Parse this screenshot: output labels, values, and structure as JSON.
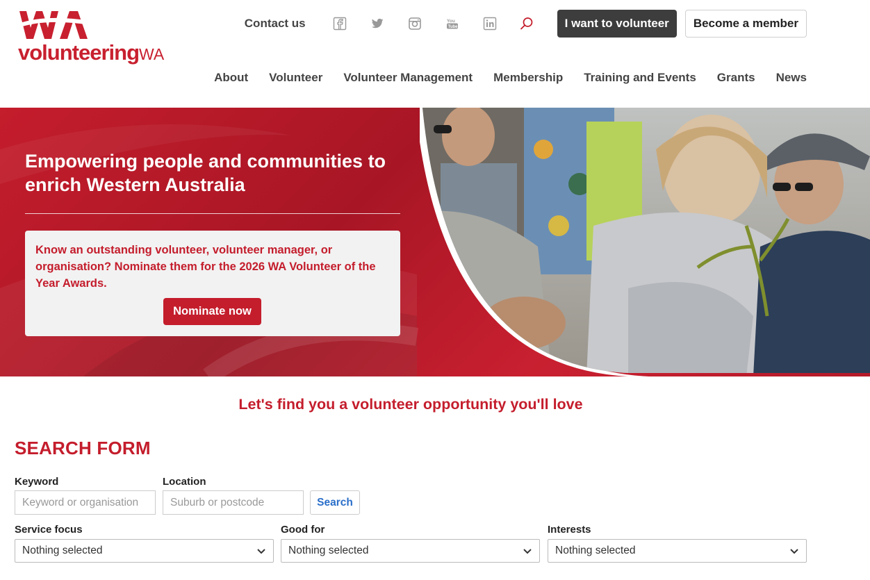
{
  "brand": {
    "logo_text_main": "volunteering",
    "logo_text_suffix": "WA",
    "colors": {
      "primary_red": "#c41d2c",
      "dark_button": "#3d3d3d",
      "link_blue": "#2a6fc9"
    }
  },
  "topbar": {
    "contact": "Contact us",
    "social_icons": [
      "facebook-icon",
      "twitter-icon",
      "instagram-icon",
      "youtube-icon",
      "linkedin-icon"
    ],
    "search_icon": "search-icon",
    "volunteer_button": "I want to volunteer",
    "member_button": "Become a member"
  },
  "nav": {
    "items": [
      {
        "label": "About"
      },
      {
        "label": "Volunteer"
      },
      {
        "label": "Volunteer Management"
      },
      {
        "label": "Membership"
      },
      {
        "label": "Training and Events"
      },
      {
        "label": "Grants"
      },
      {
        "label": "News"
      }
    ]
  },
  "hero": {
    "title": "Empowering people and communities to enrich Western Australia",
    "callout_text": "Know an outstanding volunteer, volunteer manager, or organisation? Nominate them for the 2026 WA Volunteer of the Year Awards.",
    "nominate_button": "Nominate now"
  },
  "search": {
    "tagline": "Let's find you a volunteer opportunity you'll love",
    "heading": "SEARCH FORM",
    "keyword_label": "Keyword",
    "keyword_placeholder": "Keyword or organisation",
    "location_label": "Location",
    "location_placeholder": "Suburb or postcode",
    "search_button": "Search",
    "filters": [
      {
        "label": "Service focus",
        "value": "Nothing selected"
      },
      {
        "label": "Good for",
        "value": "Nothing selected"
      },
      {
        "label": "Interests",
        "value": "Nothing selected"
      }
    ]
  }
}
